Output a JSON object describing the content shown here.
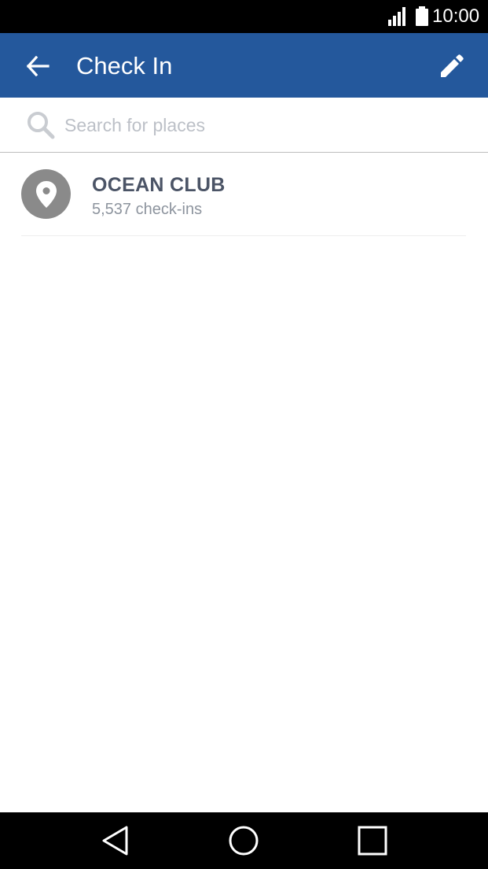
{
  "status_bar": {
    "time": "10:00"
  },
  "app_bar": {
    "title": "Check In"
  },
  "search": {
    "placeholder": "Search for places"
  },
  "places": [
    {
      "name": "OCEAN CLUB",
      "checkins": "5,537 check-ins"
    }
  ],
  "colors": {
    "app_bar": "#24589c",
    "status_bar": "#000000",
    "avatar": "#8a8a8a",
    "place_name": "#4b5466",
    "place_sub": "#8d949e"
  },
  "icons": {
    "back": "arrow-left-icon",
    "edit": "pencil-icon",
    "search": "magnifier-icon",
    "place": "map-pin-icon",
    "nav_back": "triangle-back-icon",
    "nav_home": "circle-home-icon",
    "nav_recents": "square-recents-icon"
  }
}
